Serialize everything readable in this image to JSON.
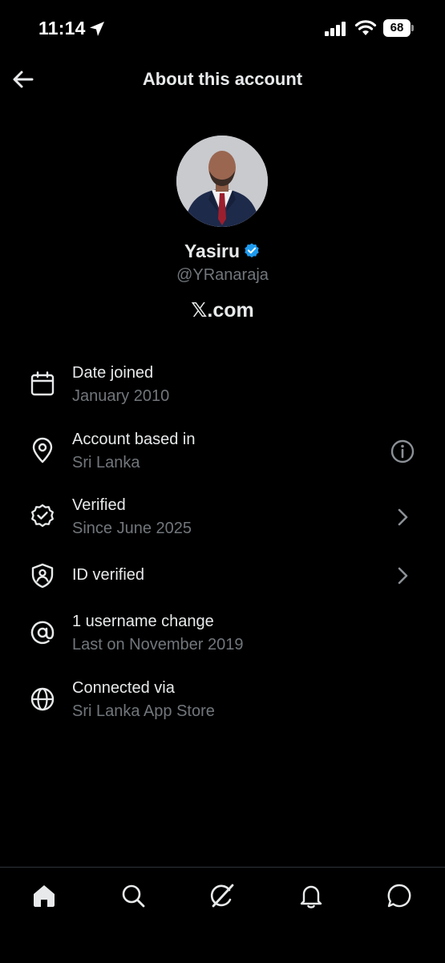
{
  "status_bar": {
    "time": "11:14",
    "battery": "68",
    "icons": [
      "location-arrow-icon",
      "signal-icon",
      "wifi-icon",
      "battery-icon"
    ]
  },
  "header": {
    "title": "About this account",
    "back_icon": "arrow-left-icon"
  },
  "profile": {
    "display_name": "Yasiru",
    "verified_badge_color": "#1d9bf0",
    "handle": "@YRanaraja",
    "affiliate": "𝕏.com"
  },
  "details": [
    {
      "icon": "calendar-icon",
      "title": "Date joined",
      "subtitle": "January 2010"
    },
    {
      "icon": "location-pin-icon",
      "title": "Account based in",
      "subtitle": "Sri Lanka",
      "action_icon": "info-icon"
    },
    {
      "icon": "verified-check-icon",
      "title": "Verified",
      "subtitle": "Since June 2025",
      "action_icon": "chevron-right-icon"
    },
    {
      "icon": "shield-person-icon",
      "title": "ID verified",
      "action_icon": "chevron-right-icon"
    },
    {
      "icon": "at-sign-icon",
      "title": "1 username change",
      "subtitle": "Last on November 2019"
    },
    {
      "icon": "globe-icon",
      "title": "Connected via",
      "subtitle": "Sri Lanka App Store"
    }
  ],
  "bottom_nav": [
    "home-icon",
    "search-icon",
    "grok-icon",
    "notifications-icon",
    "messages-icon"
  ],
  "colors": {
    "background": "#000000",
    "text_primary": "#e7e9ea",
    "text_secondary": "#71767b",
    "divider": "#2f3336",
    "verified": "#1d9bf0"
  }
}
